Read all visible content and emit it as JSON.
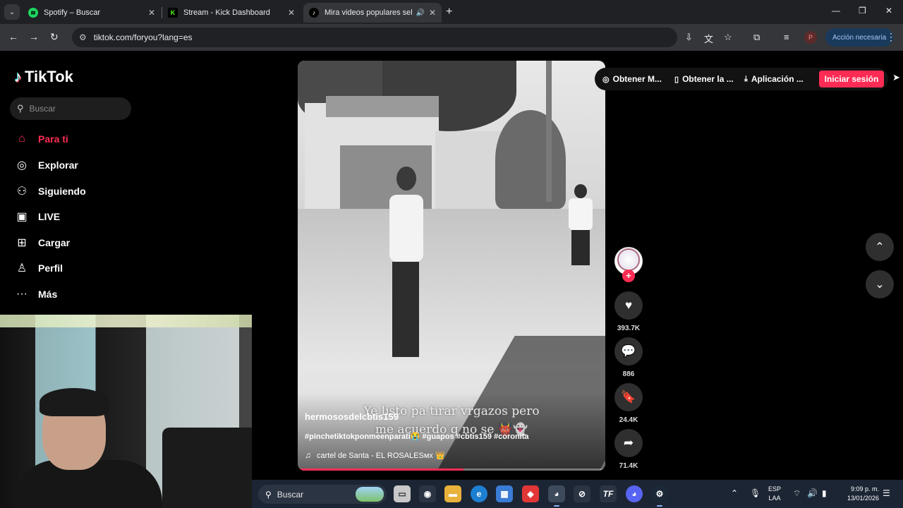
{
  "browser": {
    "tabs": [
      {
        "title": "Spotify – Buscar",
        "icon": "spotify-icon",
        "color": "#1ed760"
      },
      {
        "title": "Stream - Kick Dashboard",
        "icon": "kick-icon",
        "color": "#53fc18"
      },
      {
        "title": "Mira videos populares seleccionados",
        "icon": "tiktok-icon",
        "color": "#ffffff"
      }
    ],
    "url": "tiktok.com/foryou?lang=es",
    "profile_initial": "P",
    "action_label": "Acción necesaria"
  },
  "sidebar": {
    "logo": "TikTok",
    "search_placeholder": "Buscar",
    "items": [
      {
        "label": "Para ti",
        "icon": "home-icon",
        "active": true
      },
      {
        "label": "Explorar",
        "icon": "compass-icon"
      },
      {
        "label": "Siguiendo",
        "icon": "following-icon"
      },
      {
        "label": "LIVE",
        "icon": "live-icon"
      },
      {
        "label": "Cargar",
        "icon": "upload-icon"
      },
      {
        "label": "Perfil",
        "icon": "profile-icon"
      },
      {
        "label": "Más",
        "icon": "more-icon"
      }
    ]
  },
  "header": {
    "links": [
      "Obtener M...",
      "Obtener la ...",
      "Aplicación ..."
    ],
    "login_label": "Iniciar sesión"
  },
  "video": {
    "overlay_line1": "Ye listo pa tirar vrgazos pero",
    "overlay_line2": "me acuerdo q no se 👹👻",
    "author": "hermososdelcbtis159",
    "description": "#pinchetiktokponmeenparati😭 #guapos #cbtis159 #coronita",
    "music": "cartel de Santa - EL ROSALESмx 👑",
    "progress": 0.54
  },
  "actions": {
    "likes": "393.7K",
    "comments": "886",
    "saves": "24.4K",
    "shares": "71.4K"
  },
  "taskbar": {
    "search_placeholder": "Buscar",
    "lang_line1": "ESP",
    "lang_line2": "LAA",
    "time": "9:09 p. m.",
    "date": "13/01/2026"
  },
  "colors": {
    "accent": "#fe2c55",
    "sidebar_bg": "#000000",
    "taskbar_bg": "#1c2534"
  }
}
